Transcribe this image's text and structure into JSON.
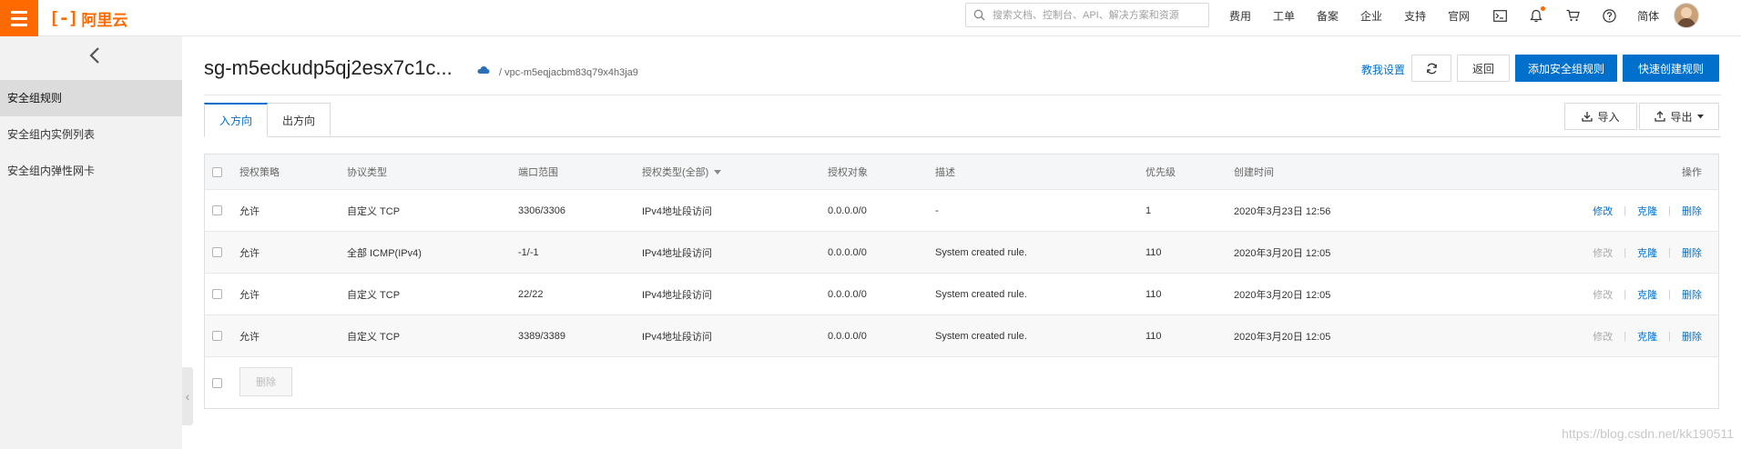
{
  "topbar": {
    "logo_mark": "[-]",
    "logo_text": "阿里云",
    "search_placeholder": "搜索文档、控制台、API、解决方案和资源",
    "nav": [
      "费用",
      "工单",
      "备案",
      "企业",
      "支持",
      "官网"
    ],
    "lang": "简体"
  },
  "sidebar": {
    "items": [
      "安全组规则",
      "安全组内实例列表",
      "安全组内弹性网卡"
    ]
  },
  "header": {
    "title": "sg-m5eckudp5qj2esx7c1c...",
    "vpc": "/ vpc-m5eqjacbm83q79x4h3ja9",
    "tutorial_link": "教我设置",
    "back_label": "返回",
    "add_rule_label": "添加安全组规则",
    "quick_rule_label": "快速创建规则"
  },
  "tabs": [
    "入方向",
    "出方向"
  ],
  "toolbar": {
    "import_label": "导入",
    "export_label": "导出"
  },
  "table": {
    "columns": [
      "授权策略",
      "协议类型",
      "端口范围",
      "授权类型(全部)",
      "授权对象",
      "描述",
      "优先级",
      "创建时间",
      "操作"
    ],
    "rows": [
      {
        "policy": "允许",
        "protocol": "自定义 TCP",
        "port": "3306/3306",
        "auth_type": "IPv4地址段访问",
        "target": "0.0.0.0/0",
        "desc": "-",
        "priority": "1",
        "created": "2020年3月23日 12:56",
        "op_modify": "修改",
        "op_clone": "克隆",
        "op_delete": "删除",
        "modify_enabled": true
      },
      {
        "policy": "允许",
        "protocol": "全部 ICMP(IPv4)",
        "port": "-1/-1",
        "auth_type": "IPv4地址段访问",
        "target": "0.0.0.0/0",
        "desc": "System created rule.",
        "priority": "110",
        "created": "2020年3月20日 12:05",
        "op_modify": "修改",
        "op_clone": "克隆",
        "op_delete": "删除",
        "modify_enabled": false
      },
      {
        "policy": "允许",
        "protocol": "自定义 TCP",
        "port": "22/22",
        "auth_type": "IPv4地址段访问",
        "target": "0.0.0.0/0",
        "desc": "System created rule.",
        "priority": "110",
        "created": "2020年3月20日 12:05",
        "op_modify": "修改",
        "op_clone": "克隆",
        "op_delete": "删除",
        "modify_enabled": false
      },
      {
        "policy": "允许",
        "protocol": "自定义 TCP",
        "port": "3389/3389",
        "auth_type": "IPv4地址段访问",
        "target": "0.0.0.0/0",
        "desc": "System created rule.",
        "priority": "110",
        "created": "2020年3月20日 12:05",
        "op_modify": "修改",
        "op_clone": "克隆",
        "op_delete": "删除",
        "modify_enabled": false
      }
    ],
    "batch_delete_label": "删除"
  },
  "watermark": "https://blog.csdn.net/kk190511",
  "colors": {
    "accent": "#0070cc",
    "brand": "#ff6a00"
  }
}
